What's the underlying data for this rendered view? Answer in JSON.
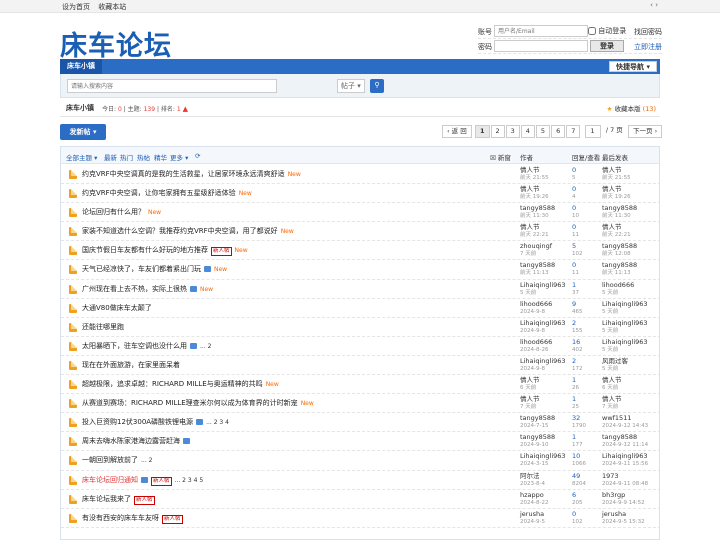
{
  "topbar": {
    "set_home": "设为首页",
    "bookmark": "收藏本站",
    "arrows": "‹ ›"
  },
  "logo": "床车论坛",
  "login": {
    "user_label": "账号",
    "user_placeholder": "用户名/Email",
    "auto_login": "自动登录",
    "forgot": "找回密码",
    "pass_label": "密码",
    "login_button": "登录",
    "register": "立即注册"
  },
  "nav": {
    "item": "床车小镇",
    "quick": "快捷导航 ▾"
  },
  "search": {
    "placeholder": "请输入搜索内容",
    "select": "帖子 ▾",
    "go_icon": "search-icon"
  },
  "forum": {
    "name": "床车小镇",
    "today_label": "今日:",
    "today": "0",
    "topics_label": "主题:",
    "topics": "139",
    "rank_label": "排名:",
    "rank": "1",
    "fav_label": "收藏本版",
    "fav_count": "(13)"
  },
  "post_button": "发新帖 ▾",
  "pager": {
    "prev": "‹ 返 回",
    "pages": [
      "1",
      "2",
      "3",
      "4",
      "5",
      "6",
      "7"
    ],
    "input": "1",
    "total": "/ 7 页",
    "next": "下一页 ›"
  },
  "filter": {
    "all": "全部主题 ▾",
    "latest": "最新",
    "hot": "热门",
    "hot2": "热帖",
    "digest": "精华",
    "more": "更多 ▾",
    "refresh": "⟳",
    "new_window": "新窗",
    "author": "作者",
    "replies": "回复/查看",
    "last": "最后发表"
  },
  "threads": [
    {
      "title": "约克VRF中央空调真的是我的生活救星，让居家环境永远清爽舒适",
      "new": "New",
      "pages": "",
      "img": false,
      "tag": "",
      "red": false,
      "author": "情人节",
      "adate": "前天 21:55",
      "replies": "0",
      "views": "5",
      "last_user": "情人节",
      "last_date": "前天 21:55"
    },
    {
      "title": "约克VRF中央空调，让你宅家拥有五星级舒适体验",
      "new": "New",
      "pages": "",
      "img": false,
      "tag": "",
      "red": false,
      "author": "情人节",
      "adate": "前天 19:26",
      "replies": "0",
      "views": "4",
      "last_user": "情人节",
      "last_date": "前天 19:26"
    },
    {
      "title": "论坛回归有什么用？",
      "new": "New",
      "pages": "",
      "img": false,
      "tag": "",
      "red": false,
      "author": "tangy8588",
      "adate": "前天 11:30",
      "replies": "0",
      "views": "10",
      "last_user": "tangy8588",
      "last_date": "前天 11:30"
    },
    {
      "title": "家装不知道选什么空调？我推荐约克VRF中央空调，用了都说好",
      "new": "New",
      "pages": "",
      "img": false,
      "tag": "",
      "red": false,
      "author": "情人节",
      "adate": "前天 22:21",
      "replies": "0",
      "views": "11",
      "last_user": "情人节",
      "last_date": "前天 22:21"
    },
    {
      "title": "国庆节假日车友都有什么好玩的地方推荐",
      "new": "New",
      "pages": "",
      "img": false,
      "tag": "新人帖",
      "red": false,
      "author": "zhouqingf",
      "adate": "7 天前",
      "replies": "5",
      "views": "102",
      "last_user": "tangy8588",
      "last_date": "前天 12:08"
    },
    {
      "title": "天气已经凉快了，车友们都着紧出门玩",
      "new": "New",
      "pages": "",
      "img": true,
      "tag": "",
      "red": false,
      "author": "tangy8588",
      "adate": "前天 11:13",
      "replies": "0",
      "views": "11",
      "last_user": "tangy8588",
      "last_date": "前天 11:13"
    },
    {
      "title": "广州现在看上去不热，实际上很热",
      "new": "New",
      "pages": "",
      "img": true,
      "tag": "",
      "red": false,
      "author": "Lihaiqingli963",
      "adate": "5 天前",
      "replies": "1",
      "views": "37",
      "last_user": "lihood666",
      "last_date": "5 天前"
    },
    {
      "title": "大通V80做床车太颠了",
      "new": "",
      "pages": "",
      "img": false,
      "tag": "",
      "red": false,
      "author": "lihood666",
      "adate": "2024-9-8",
      "replies": "9",
      "views": "465",
      "last_user": "Lihaiqingli963",
      "last_date": "5 天前"
    },
    {
      "title": "还能往哪里跑",
      "new": "",
      "pages": "",
      "img": false,
      "tag": "",
      "red": false,
      "author": "Lihaiqingli963",
      "adate": "2024-9-8",
      "replies": "2",
      "views": "155",
      "last_user": "Lihaiqingli963",
      "last_date": "5 天前"
    },
    {
      "title": "太阳暴晒下，驻车空调也没什么用",
      "new": "",
      "pages": "... 2",
      "img": true,
      "tag": "",
      "red": false,
      "author": "lihood666",
      "adate": "2024-8-26",
      "replies": "16",
      "views": "402",
      "last_user": "Lihaiqingli963",
      "last_date": "5 天前"
    },
    {
      "title": "现在在外面旅游，在家里面呆着",
      "new": "",
      "pages": "",
      "img": false,
      "tag": "",
      "red": false,
      "author": "Lihaiqingli963",
      "adate": "2024-9-8",
      "replies": "2",
      "views": "172",
      "last_user": "风雨过客",
      "last_date": "5 天前"
    },
    {
      "title": "超越极限，追求卓越：RICHARD MILLE与奥运精神的共鸣",
      "new": "New",
      "pages": "",
      "img": false,
      "tag": "",
      "red": false,
      "author": "情人节",
      "adate": "6 天前",
      "replies": "1",
      "views": "26",
      "last_user": "情人节",
      "last_date": "6 天前"
    },
    {
      "title": "从赛道到赛场：RICHARD MILLE理查米尔何以成为体育界的计时新宠",
      "new": "New",
      "pages": "",
      "img": false,
      "tag": "",
      "red": false,
      "author": "情人节",
      "adate": "7 天前",
      "replies": "1",
      "views": "25",
      "last_user": "情人节",
      "last_date": "7 天前"
    },
    {
      "title": "投入巨资购12伏300A磷酸铁锂电源",
      "new": "",
      "pages": "... 2 3 4",
      "img": true,
      "tag": "",
      "red": false,
      "author": "tangy8588",
      "adate": "2024-7-15",
      "replies": "32",
      "views": "1790",
      "last_user": "wwf1511",
      "last_date": "2024-9-12 14:43"
    },
    {
      "title": "周末去嗨水陈家港海边露营赶海",
      "new": "",
      "pages": "",
      "img": true,
      "tag": "",
      "red": false,
      "author": "tangy8588",
      "adate": "2024-9-10",
      "replies": "1",
      "views": "177",
      "last_user": "tangy8588",
      "last_date": "2024-9-12 11:14"
    },
    {
      "title": "一朝回到解放前了",
      "new": "",
      "pages": "... 2",
      "img": false,
      "tag": "",
      "red": false,
      "author": "Lihaiqingli963",
      "adate": "2024-3-15",
      "replies": "10",
      "views": "1066",
      "last_user": "Lihaiqingli963",
      "last_date": "2024-9-11 15:56"
    },
    {
      "title": "床车论坛回归通知",
      "new": "",
      "pages": "... 2 3 4 5",
      "img": true,
      "tag": "新人帖",
      "red": true,
      "author": "阿尔法",
      "adate": "2023-8-4",
      "replies": "49",
      "views": "8204",
      "last_user": "1973",
      "last_date": "2024-9-11 08:48"
    },
    {
      "title": "床车论坛我来了",
      "new": "",
      "pages": "",
      "img": false,
      "tag": "新人帖",
      "red": false,
      "author": "hzappo",
      "adate": "2024-8-22",
      "replies": "6",
      "views": "205",
      "last_user": "bh3rgp",
      "last_date": "2024-9-9 14:52"
    },
    {
      "title": "有没有西安的床车车友呀",
      "new": "",
      "pages": "",
      "img": false,
      "tag": "新人帖",
      "red": false,
      "author": "jerusha",
      "adate": "2024-9-5",
      "replies": "0",
      "views": "102",
      "last_user": "jerusha",
      "last_date": "2024-9-5 15:32"
    },
    {
      "title": "",
      "new": "",
      "pages": "",
      "img": false,
      "tag": "",
      "red": false,
      "author": "",
      "adate": "",
      "replies": "",
      "views": "",
      "last_user": "",
      "last_date": ""
    }
  ]
}
